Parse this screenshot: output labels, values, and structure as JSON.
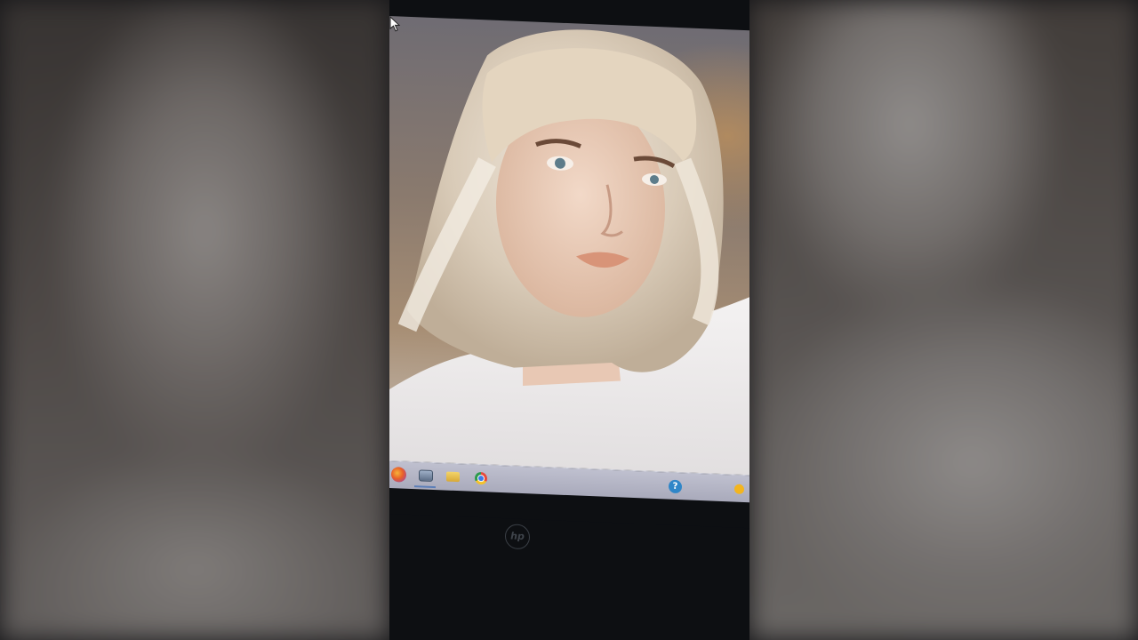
{
  "scene": {
    "description_free": true
  },
  "desktop": {
    "wallpaper_icon": "portrait-photo",
    "cursor_icon": "arrow-cursor"
  },
  "taskbar": {
    "pinned": [
      {
        "icon": "firefox-icon"
      },
      {
        "icon": "monitor-icon"
      },
      {
        "icon": "file-explorer-icon"
      },
      {
        "icon": "chrome-icon"
      }
    ],
    "tray": {
      "help_glyph": "?",
      "status_icon": "notification-dot-icon"
    }
  },
  "bezel": {
    "logo_text": "hp"
  },
  "colors": {
    "taskbar": "#b4b5c6",
    "bezel": "#0d0f12",
    "help": "#2f86c8",
    "status_dot": "#f3b51f"
  }
}
